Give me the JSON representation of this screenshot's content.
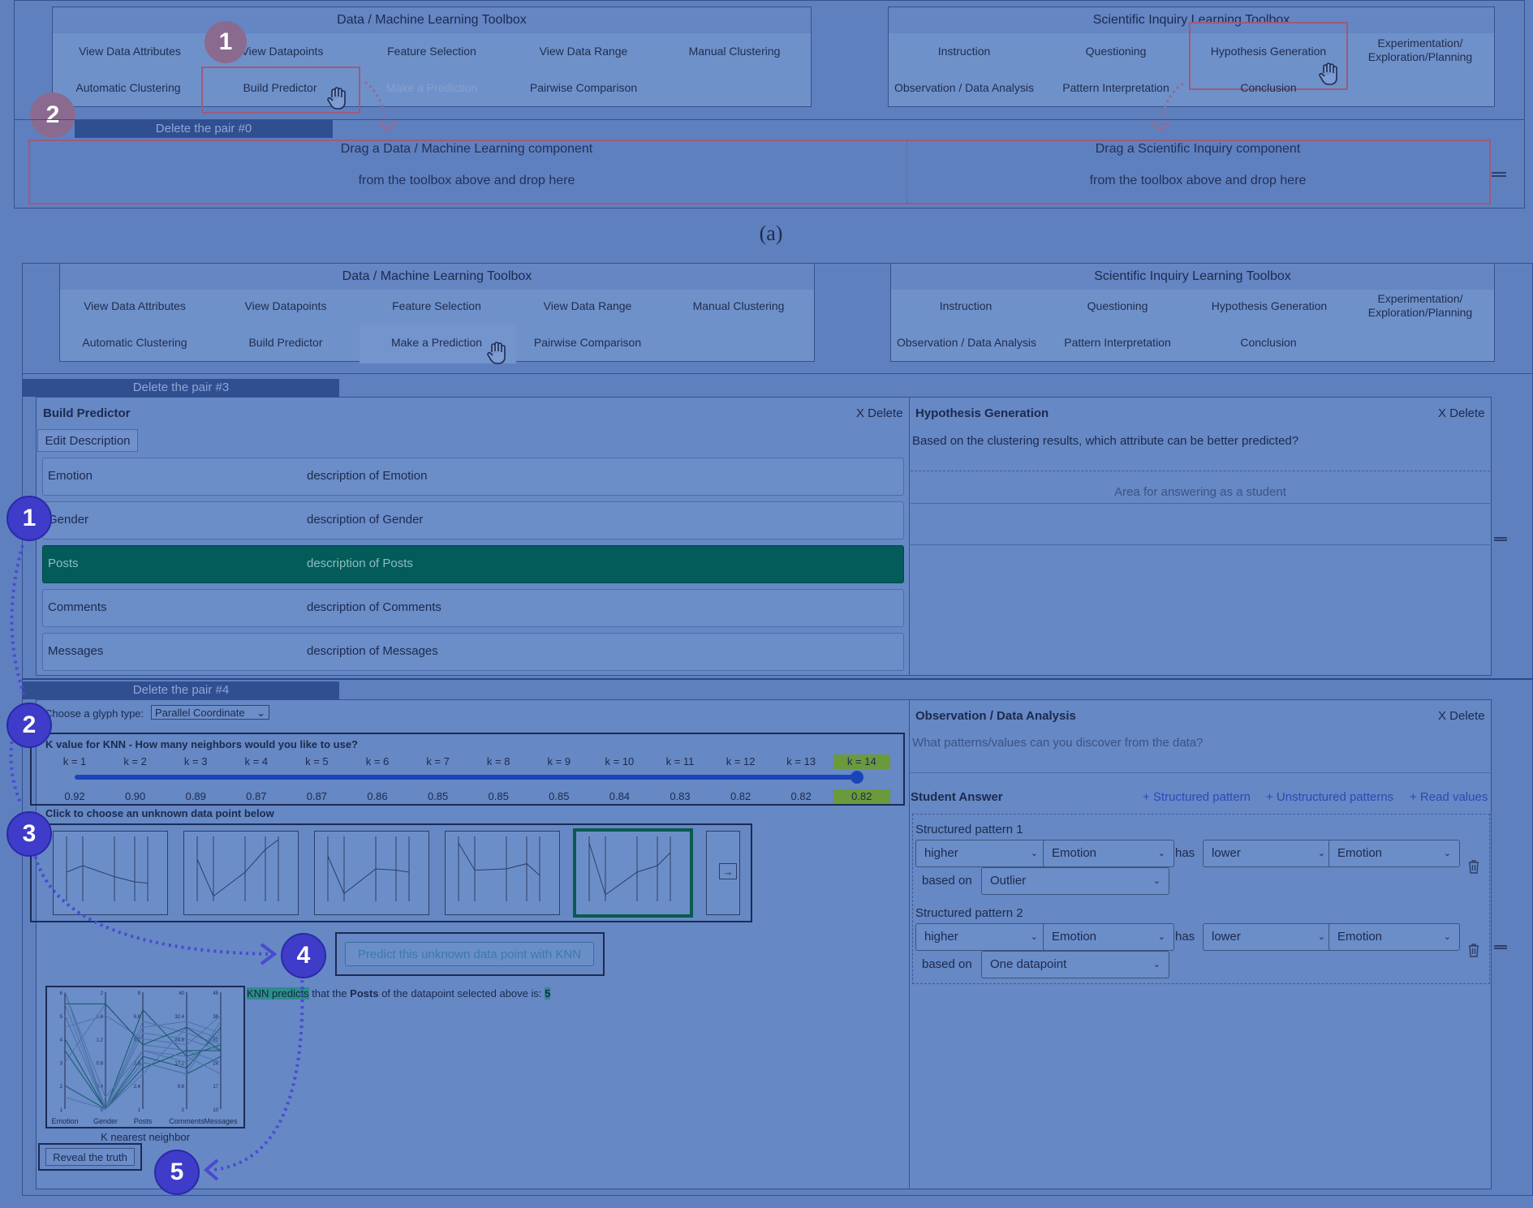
{
  "panel_a": {
    "data_toolbox": {
      "title": "Data / Machine Learning Toolbox",
      "items": [
        "View Data Attributes",
        "View Datapoints",
        "Feature Selection",
        "View Data Range",
        "Manual Clustering",
        "Automatic Clustering",
        "Build Predictor",
        "Make a Prediction",
        "Pairwise Comparison"
      ]
    },
    "inquiry_toolbox": {
      "title": "Scientific Inquiry Learning Toolbox",
      "items": [
        "Instruction",
        "Questioning",
        "Hypothesis Generation",
        "Experimentation/ Exploration/Planning",
        "Observation / Data Analysis",
        "Pattern Interpretation",
        "Conclusion"
      ]
    },
    "delete_pair": "Delete the pair #0",
    "drop_left": [
      "Drag a Data / Machine Learning component",
      "from the toolbox above and drop here"
    ],
    "drop_right": [
      "Drag a Scientific Inquiry component",
      "from the toolbox above and drop here"
    ],
    "badges": [
      "1",
      "2"
    ]
  },
  "caption_a": "(a)",
  "panel_b": {
    "data_toolbox": {
      "title": "Data / Machine Learning Toolbox",
      "items": [
        "View Data Attributes",
        "View Datapoints",
        "Feature Selection",
        "View Data Range",
        "Manual Clustering",
        "Automatic Clustering",
        "Build Predictor",
        "Make a Prediction",
        "Pairwise Comparison"
      ]
    },
    "inquiry_toolbox": {
      "title": "Scientific Inquiry Learning Toolbox",
      "items": [
        "Instruction",
        "Questioning",
        "Hypothesis Generation",
        "Experimentation/ Exploration/Planning",
        "Observation / Data Analysis",
        "Pattern Interpretation",
        "Conclusion"
      ]
    },
    "pair3": {
      "delete_label": "Delete the pair #3",
      "build_predictor": {
        "title": "Build Predictor",
        "delete": "X Delete",
        "edit_description": "Edit Description",
        "attributes": [
          {
            "name": "Emotion",
            "desc": "description of Emotion"
          },
          {
            "name": "Gender",
            "desc": "description of Gender"
          },
          {
            "name": "Posts",
            "desc": "description of Posts"
          },
          {
            "name": "Comments",
            "desc": "description of Comments"
          },
          {
            "name": "Messages",
            "desc": "description of Messages"
          }
        ],
        "selected_attribute": "Posts"
      },
      "hypothesis": {
        "title": "Hypothesis Generation",
        "delete": "X Delete",
        "question": "Based on the clustering results, which attribute can be better predicted?",
        "answer_area_label": "Area for answering as a student"
      }
    },
    "pair4": {
      "delete_label": "Delete the pair #4",
      "glyph_label": "Choose a glyph type:",
      "glyph_value": "Parallel Coordinate",
      "knn_question": "K value for KNN - How many neighbors would you like to use?",
      "k_labels": [
        "k = 1",
        "k = 2",
        "k = 3",
        "k = 4",
        "k = 5",
        "k = 6",
        "k = 7",
        "k = 8",
        "k = 9",
        "k = 10",
        "k = 11",
        "k = 12",
        "k = 13",
        "k = 14"
      ],
      "accuracies": [
        "0.92",
        "0.90",
        "0.89",
        "0.87",
        "0.87",
        "0.86",
        "0.85",
        "0.85",
        "0.85",
        "0.84",
        "0.83",
        "0.82",
        "0.82",
        "0.82"
      ],
      "selected_k": 14,
      "unknown_label": "Click to choose an unknown data point below",
      "predict_button": "Predict this unknown data point with KNN",
      "prediction_prefix": "KNN predicts",
      "prediction_mid": " that the ",
      "prediction_attr": "Posts",
      "prediction_suffix": " of the datapoint selected above is: ",
      "prediction_value": "5",
      "knn_plot": {
        "axes": [
          "Emotion",
          "Gender",
          "Posts",
          "Comments",
          "Messages"
        ],
        "ticks": {
          "Emotion": [
            "6",
            "5",
            "4",
            "3",
            "2",
            "1"
          ],
          "Gender": [
            "2",
            "1.6",
            "1.2",
            "0.8",
            "0.4",
            "0"
          ],
          "Posts": [
            "8",
            "6.6",
            "5.2",
            "3.8",
            "2.4",
            "1"
          ],
          "Comments": [
            "40",
            "32.4",
            "24.8",
            "17.2",
            "9.6",
            "2"
          ],
          "Messages": [
            "45",
            "38",
            "31",
            "24",
            "17",
            "10"
          ]
        },
        "caption": "K nearest neighbor"
      },
      "reveal_button": "Reveal the truth",
      "observation": {
        "title": "Observation / Data Analysis",
        "delete": "X Delete",
        "placeholder": "What patterns/values can you discover from the data?",
        "student_answer": "Student Answer",
        "links": [
          "+ Structured pattern",
          "+ Unstructured patterns",
          "+ Read values"
        ],
        "patterns": [
          {
            "title": "Structured pattern 1",
            "a": "higher",
            "b": "Emotion",
            "has": "has",
            "c": "lower",
            "d": "Emotion",
            "based_on": "based on",
            "basis": "Outlier"
          },
          {
            "title": "Structured pattern 2",
            "a": "higher",
            "b": "Emotion",
            "has": "has",
            "c": "lower",
            "d": "Emotion",
            "based_on": "based on",
            "basis": "One datapoint"
          }
        ]
      }
    },
    "badges": [
      "1",
      "2",
      "3",
      "4",
      "5"
    ]
  }
}
